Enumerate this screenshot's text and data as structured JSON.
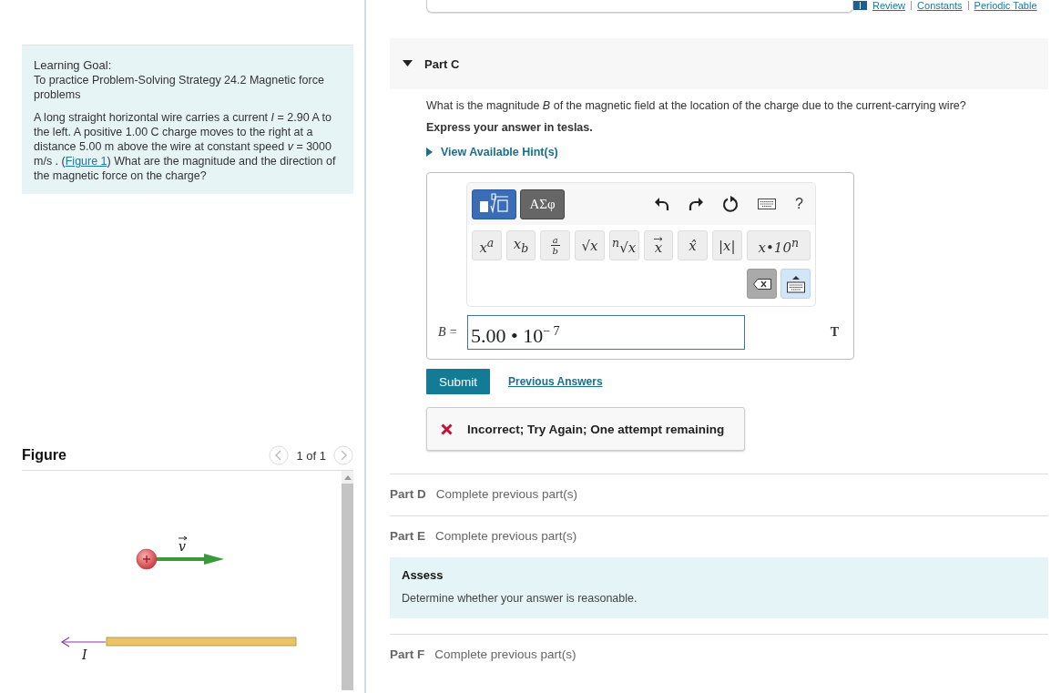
{
  "top_links": [
    {
      "label": "Review"
    },
    {
      "label": "Constants"
    },
    {
      "label": "Periodic Table"
    }
  ],
  "intro": {
    "title": "Learning Goal:",
    "goal": "To practice Problem-Solving Strategy 24.2 Magnetic force problems",
    "problem_before": "A long straight horizontal wire carries a current *I* = 2.90 A to the left. A positive 1.00 C charge moves to the right at a distance 5.00 m above the wire at constant speed *v* = 3000 m/s . (",
    "figure_link": "Figure 1",
    "problem_after": ") What are the magnitude and the direction of the magnetic force on the charge?"
  },
  "figure": {
    "title": "Figure",
    "pager": "1 of 1",
    "velocity_label": "v",
    "current_label": "I"
  },
  "parts": [
    {
      "kind": "question",
      "label": "Part C",
      "expanded": true,
      "question": "What is the magnitude *B* of the magnetic field at the location of the charge due to the current-carrying wire?",
      "instruction": "Express your answer in teslas.",
      "hint_link": "View Available Hint(s)",
      "editor": {
        "tabs": [
          {
            "kind": "templates",
            "selected": true
          },
          {
            "kind": "greek",
            "label": "ΑΣφ",
            "selected": false
          }
        ],
        "help": "?",
        "templates": [
          {
            "kind": "text",
            "label": "x$^{a}$"
          },
          {
            "kind": "text",
            "label": "x$_{b}$"
          },
          {
            "kind": "fraction",
            "num": "a",
            "den": "b"
          },
          {
            "kind": "text",
            "label": "√x"
          },
          {
            "kind": "text",
            "label": "$^{n}$√x"
          },
          {
            "kind": "vector",
            "label": "x"
          },
          {
            "kind": "text",
            "label": "x̂"
          },
          {
            "kind": "text",
            "label": "|x|"
          },
          {
            "kind": "wide",
            "label": "x•10$^{n}$"
          }
        ]
      },
      "answer": {
        "variable": "B =",
        "value": "5.00 • 10$^{− 7}$",
        "unit": "T"
      },
      "submit": "Submit",
      "previous_answers": "Previous Answers",
      "feedback": {
        "kind": "incorrect",
        "text": "Incorrect; Try Again; One attempt remaining"
      }
    },
    {
      "kind": "locked",
      "label": "Part D",
      "status": "Complete previous part(s)"
    },
    {
      "kind": "locked",
      "label": "Part E",
      "status": "Complete previous part(s)"
    },
    {
      "kind": "assess",
      "title": "Assess",
      "text": "Determine whether your answer is reasonable."
    },
    {
      "kind": "locked",
      "label": "Part F",
      "status": "Complete previous part(s)"
    }
  ]
}
